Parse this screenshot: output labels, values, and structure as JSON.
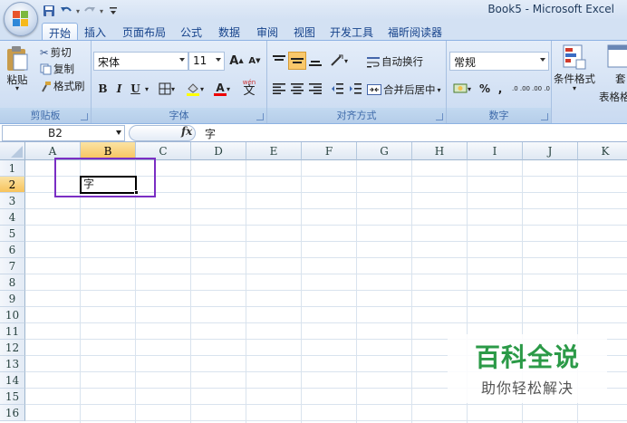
{
  "window": {
    "title": "Book5 - Microsoft Excel"
  },
  "quick_access": {
    "icons": [
      "save-icon",
      "undo-icon",
      "redo-icon",
      "customize-qat-icon"
    ]
  },
  "tabs": [
    {
      "label": "开始",
      "active": true
    },
    {
      "label": "插入"
    },
    {
      "label": "页面布局"
    },
    {
      "label": "公式"
    },
    {
      "label": "数据"
    },
    {
      "label": "审阅"
    },
    {
      "label": "视图"
    },
    {
      "label": "开发工具"
    },
    {
      "label": "福昕阅读器"
    }
  ],
  "ribbon": {
    "clipboard": {
      "paste": "粘贴",
      "cut": "剪切",
      "copy": "复制",
      "format_painter": "格式刷",
      "group_label": "剪贴板"
    },
    "font": {
      "font_name": "宋体",
      "font_size": "11",
      "grow": "A",
      "shrink": "A",
      "bold": "B",
      "italic": "I",
      "underline": "U",
      "phonetic": "wén",
      "phonetic_char": "文",
      "font_color_letter": "A",
      "group_label": "字体"
    },
    "alignment": {
      "wrap_text": "自动换行",
      "merge_center": "合并后居中",
      "group_label": "对齐方式"
    },
    "number": {
      "format": "常规",
      "percent": "%",
      "comma": ",",
      "inc_decimal": ".0 .00",
      "dec_decimal": ".00 .0",
      "group_label": "数字"
    },
    "styles": {
      "conditional_format": "条件格式",
      "table_format_top": "套",
      "table_format_bottom": "表格格"
    }
  },
  "formula_bar": {
    "name_box": "B2",
    "fx": "fx",
    "content": "字"
  },
  "sheet": {
    "columns": [
      "A",
      "B",
      "C",
      "D",
      "E",
      "F",
      "G",
      "H",
      "I",
      "J",
      "K"
    ],
    "rows": [
      "1",
      "2",
      "3",
      "4",
      "5",
      "6",
      "7",
      "8",
      "9",
      "10",
      "11",
      "12",
      "13",
      "14",
      "15",
      "16"
    ],
    "selected_column": "B",
    "selected_row": "2",
    "cells": {
      "B2": "字"
    }
  },
  "watermark": {
    "title": "百科全说",
    "subtitle": "助你轻松解决"
  },
  "colors": {
    "accent": "#15428b",
    "annotation": "#7a2ec4",
    "watermark": "#2b9a47"
  }
}
